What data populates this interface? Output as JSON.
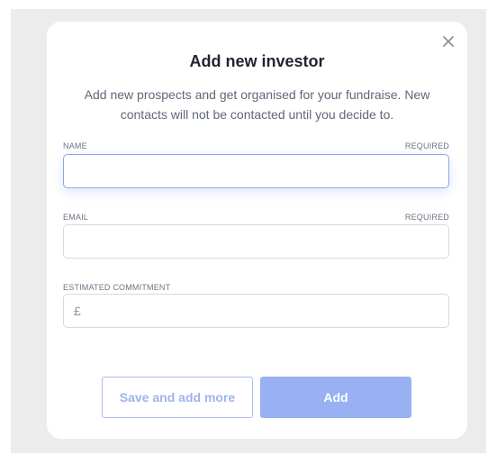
{
  "modal": {
    "title": "Add new investor",
    "description": "Add new prospects and get organised for your fundraise. New contacts will not be contacted until you decide to.",
    "close_icon": "close-icon"
  },
  "fields": {
    "name": {
      "label": "NAME",
      "required": "REQUIRED",
      "value": "",
      "placeholder": ""
    },
    "email": {
      "label": "EMAIL",
      "required": "REQUIRED",
      "value": "",
      "placeholder": ""
    },
    "commitment": {
      "label": "ESTIMATED COMMITMENT",
      "currency": "£",
      "value": "",
      "placeholder": ""
    }
  },
  "actions": {
    "save_and_add_more": "Save and add more",
    "add": "Add"
  },
  "colors": {
    "accent": "#99b1f2",
    "backdrop": "#ececec",
    "title": "#1f2433"
  }
}
